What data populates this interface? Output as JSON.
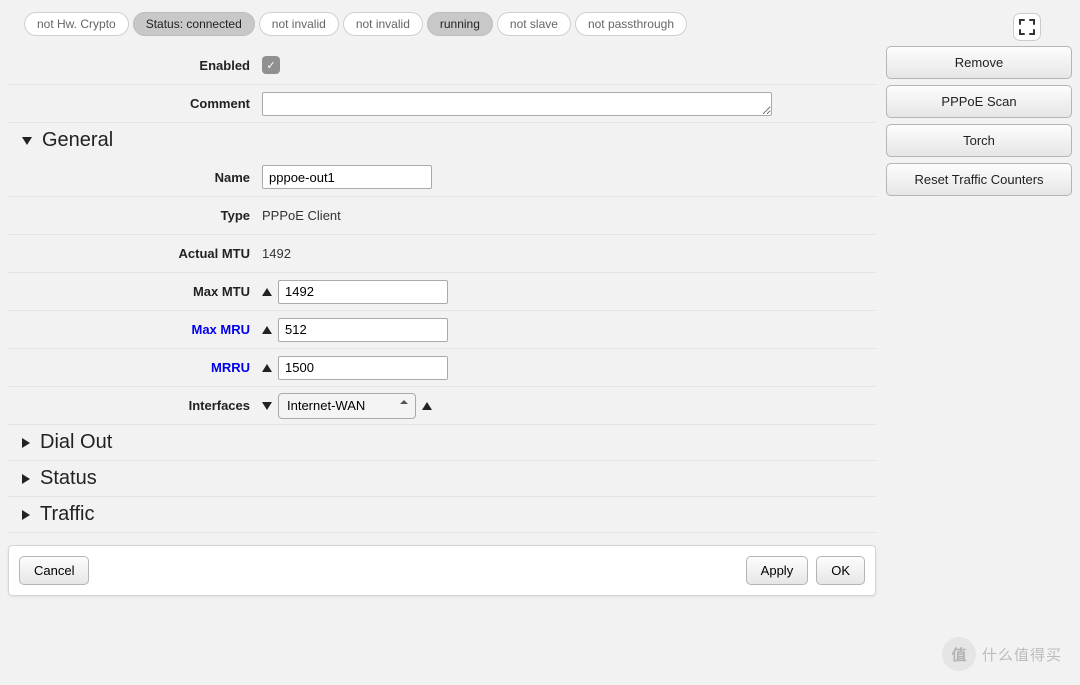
{
  "pills": [
    {
      "label": "not Hw. Crypto",
      "on": false
    },
    {
      "label": "Status: connected",
      "on": true
    },
    {
      "label": "not invalid",
      "on": false
    },
    {
      "label": "not invalid",
      "on": false
    },
    {
      "label": "running",
      "on": true
    },
    {
      "label": "not slave",
      "on": false
    },
    {
      "label": "not passthrough",
      "on": false
    }
  ],
  "form": {
    "enabled_label": "Enabled",
    "enabled_value": true,
    "comment_label": "Comment",
    "comment_value": ""
  },
  "sections": {
    "general": {
      "title": "General",
      "open": true,
      "name_label": "Name",
      "name_value": "pppoe-out1",
      "type_label": "Type",
      "type_value": "PPPoE Client",
      "actual_mtu_label": "Actual MTU",
      "actual_mtu_value": "1492",
      "max_mtu_label": "Max MTU",
      "max_mtu_value": "1492",
      "max_mru_label": "Max MRU",
      "max_mru_value": "512",
      "mrru_label": "MRRU",
      "mrru_value": "1500",
      "interfaces_label": "Interfaces",
      "interfaces_value": "Internet-WAN"
    },
    "dial_out": {
      "title": "Dial Out",
      "open": false
    },
    "status": {
      "title": "Status",
      "open": false
    },
    "traffic": {
      "title": "Traffic",
      "open": false
    }
  },
  "sidebar": {
    "remove": "Remove",
    "pppoe_scan": "PPPoE Scan",
    "torch": "Torch",
    "reset_counters": "Reset Traffic Counters"
  },
  "footer": {
    "cancel": "Cancel",
    "apply": "Apply",
    "ok": "OK"
  },
  "watermark": "什么值得买"
}
